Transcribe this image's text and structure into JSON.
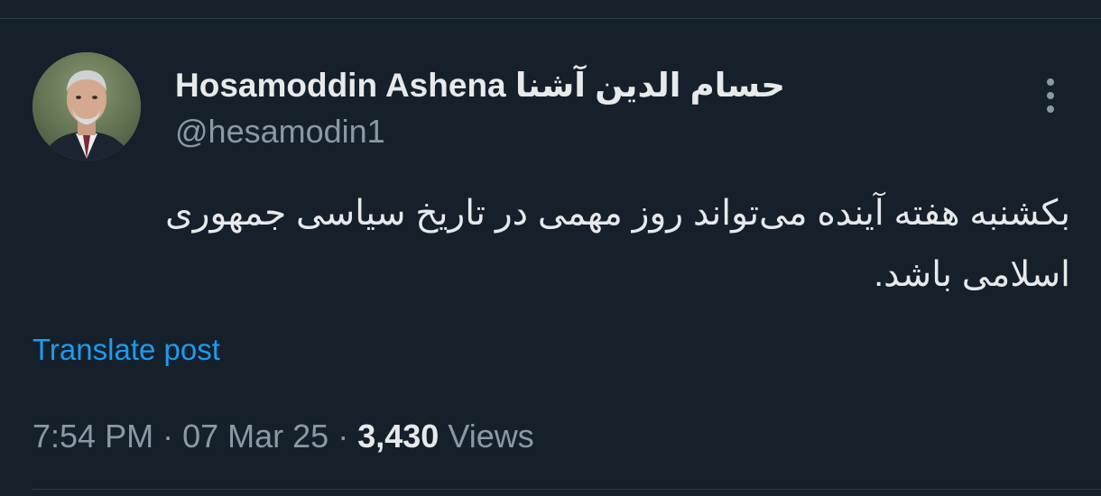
{
  "author": {
    "display_name": "Hosamoddin Ashena حسام الدین آشنا",
    "handle": "@hesamodin1",
    "avatar_icon": "profile-photo"
  },
  "menu": {
    "more_icon": "vertical-ellipsis-icon"
  },
  "post": {
    "text": "بکشنبه هفته آینده می‌تواند روز مهمی در تاریخ سیاسی جمهوری اسلامی باشد.",
    "translate_label": "Translate post"
  },
  "meta": {
    "time": "7:54 PM",
    "date": "07 Mar 25",
    "separator": "·",
    "views_count": "3,430",
    "views_label": "Views"
  },
  "colors": {
    "background": "#15202b",
    "link": "#1d9bf0",
    "secondary_text": "#8b98a5",
    "primary_text": "#e7e9ea"
  }
}
